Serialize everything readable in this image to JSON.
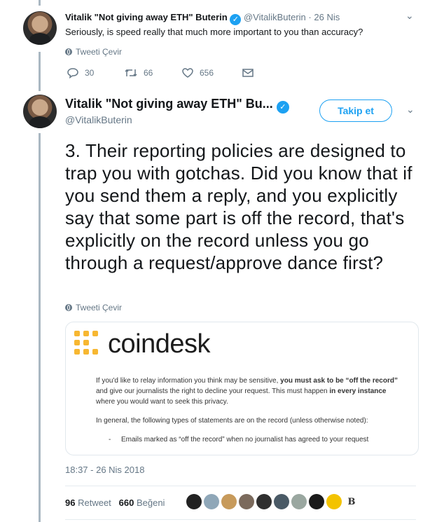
{
  "reply": {
    "author_name": "Vitalik \"Not giving away ETH\" Buterin",
    "handle": "@VitalikButerin",
    "separator": "·",
    "time": "26 Nis",
    "text": "Seriously, is speed really that much more important to you than accuracy?",
    "translate_label": "Tweeti Çevir",
    "reply_count": "30",
    "retweet_count": "66",
    "like_count": "656"
  },
  "main": {
    "author_name": "Vitalik \"Not giving away ETH\" Bu...",
    "handle": "@VitalikButerin",
    "follow_label": "Takip et",
    "text": "3. Their reporting policies are designed to trap you with gotchas. Did you know that if you send them a reply, and you explicitly say that some part is off the record, that's explicitly on the record unless you go through a request/approve dance first?",
    "translate_label": "Tweeti Çevir",
    "media": {
      "brand": "coindesk",
      "p1_a": "If you'd like to relay information you think may be sensitive, ",
      "p1_b": "you must ask to be “off the record”",
      "p1_c": " and give our journalists the right to decline your request. This must happen ",
      "p1_d": "in every instance",
      "p1_e": " where you would want to seek this privacy.",
      "p2": "In general, the following types of statements are on the record (unless otherwise noted):",
      "bullet": "-",
      "li1": "Emails marked as “off the record” when no journalist has agreed to your request"
    },
    "timestamp": "18:37 - 26 Nis 2018",
    "retweets_count": "96",
    "retweets_label": "Retweet",
    "likes_count": "660",
    "likes_label": "Beğeni"
  },
  "likers": [
    {
      "name": "liker-1",
      "color": "#222222"
    },
    {
      "name": "liker-2",
      "color": "#8fa7b8"
    },
    {
      "name": "liker-3",
      "color": "#c79a5b"
    },
    {
      "name": "liker-4",
      "color": "#7b6a5c"
    },
    {
      "name": "liker-5",
      "color": "#2f2f2f"
    },
    {
      "name": "liker-6",
      "color": "#4a5a66"
    },
    {
      "name": "liker-7",
      "color": "#9aa7a0"
    },
    {
      "name": "liker-8",
      "color": "#1a1a1a"
    },
    {
      "name": "liker-9",
      "color": "#f3c300"
    }
  ],
  "liker_extra": "B",
  "colors": {
    "accent": "#1da1f2",
    "muted": "#657786",
    "thread_line": "#aab8c2",
    "coindesk_mark": "#f7b731"
  }
}
